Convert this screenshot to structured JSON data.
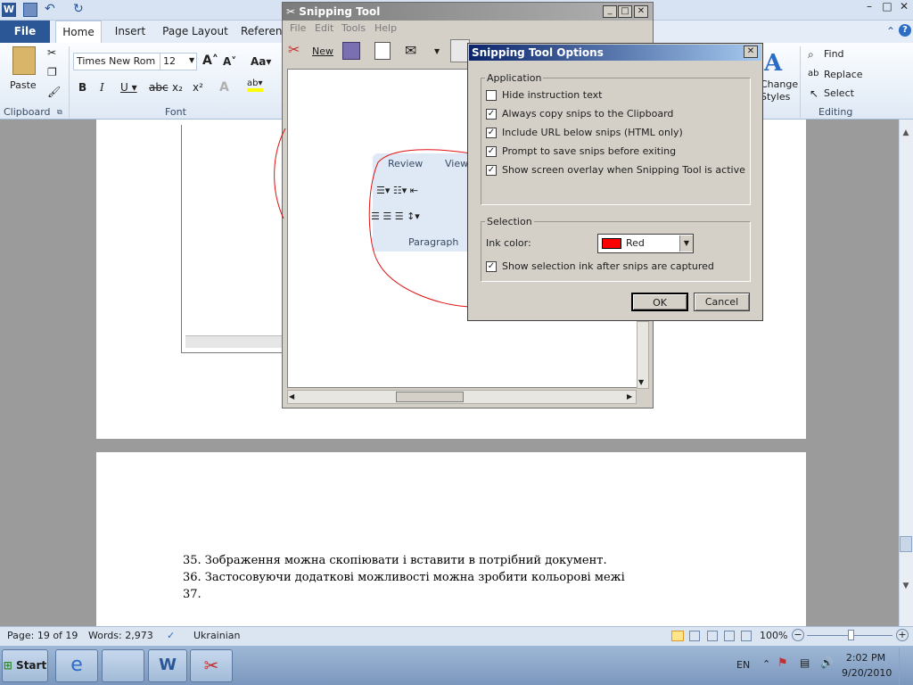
{
  "word": {
    "title_controls": {
      "minimize": "–",
      "maximize": "□",
      "close": "✕"
    },
    "tabs": [
      "File",
      "Home",
      "Insert",
      "Page Layout",
      "Referen"
    ],
    "ribbon": {
      "paste": "Paste",
      "font_name": "Times New Rom",
      "font_size": "12",
      "clipboard_group": "Clipboard",
      "font_group": "Font",
      "change_styles": "Change\nStyles",
      "find": "Find",
      "replace": "Replace",
      "select": "Select",
      "editing_group": "Editing"
    },
    "doc_lines": [
      "35. Зображення можна скопіювати і вставити в потрібний документ.",
      "36. Застосовуючи додаткові можливості можна зробити кольорові межі",
      "37."
    ],
    "snip_preview": {
      "review": "Review",
      "view": "View",
      "paragraph": "Paragraph"
    },
    "status": {
      "page": "Page: 19 of 19",
      "words": "Words: 2,973",
      "language": "Ukrainian",
      "zoom": "100%"
    }
  },
  "snipping_tool": {
    "title": "Snipping Tool",
    "menus": [
      "File",
      "Edit",
      "Tools",
      "Help"
    ],
    "new_label": "New"
  },
  "options_dialog": {
    "title": "Snipping Tool Options",
    "application_legend": "Application",
    "options": [
      {
        "label": "Hide instruction text",
        "checked": false
      },
      {
        "label": "Always copy snips to the Clipboard",
        "checked": true
      },
      {
        "label": "Include URL below snips (HTML only)",
        "checked": true
      },
      {
        "label": "Prompt to save snips before exiting",
        "checked": true
      },
      {
        "label": "Show screen overlay when Snipping Tool is active",
        "checked": true
      }
    ],
    "selection_legend": "Selection",
    "ink_color_label": "Ink color:",
    "ink_color_value": "Red",
    "ink_color_hex": "#ff0000",
    "show_ink": {
      "label": "Show selection ink after snips are captured",
      "checked": true
    },
    "ok": "OK",
    "cancel": "Cancel"
  },
  "taskbar": {
    "start": "Start",
    "lang": "EN",
    "time": "2:02 PM",
    "date": "9/20/2010"
  }
}
